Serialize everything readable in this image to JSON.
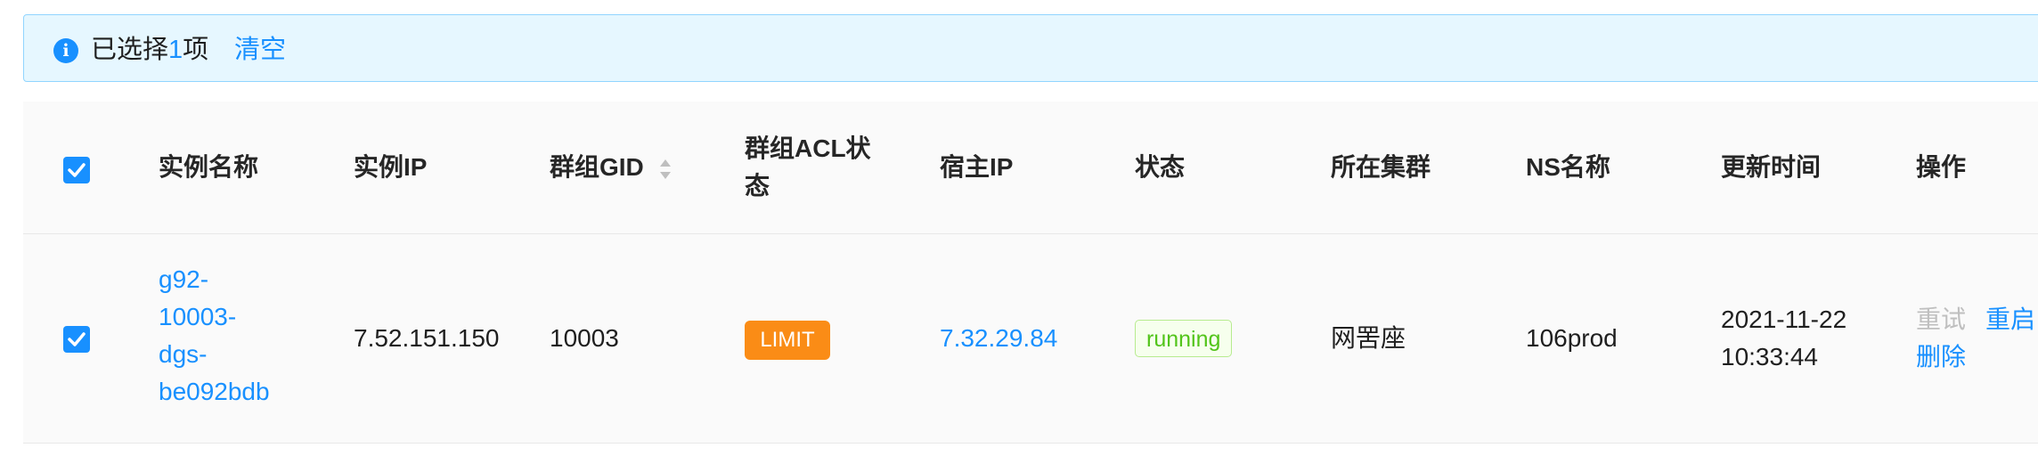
{
  "alert": {
    "icon": "info-icon",
    "prefix": "已选择",
    "count": "1",
    "suffix": "项",
    "clear_label": "清空"
  },
  "table": {
    "columns": [
      "实例名称",
      "实例IP",
      "群组GID",
      "群组ACL状\n态",
      "宿主IP",
      "状态",
      "所在集群",
      "NS名称",
      "更新时间",
      "操作"
    ],
    "rows": [
      {
        "checked": true,
        "name_lines": [
          "g92-",
          "10003-",
          "dgs-",
          "be092bdb"
        ],
        "ip": "7.52.151.150",
        "gid": "10003",
        "acl_status": "LIMIT",
        "host_ip": "7.32.29.84",
        "status": "running",
        "cluster": "网罟座",
        "ns": "106prod",
        "updated_lines": [
          "2021-11-22",
          "10:33:44"
        ],
        "actions": {
          "retry": "重试",
          "restart": "重启",
          "delete": "删除"
        }
      }
    ]
  },
  "colors": {
    "primary": "#1890ff",
    "orange": "#fa8c16",
    "success": "#52c41a"
  }
}
